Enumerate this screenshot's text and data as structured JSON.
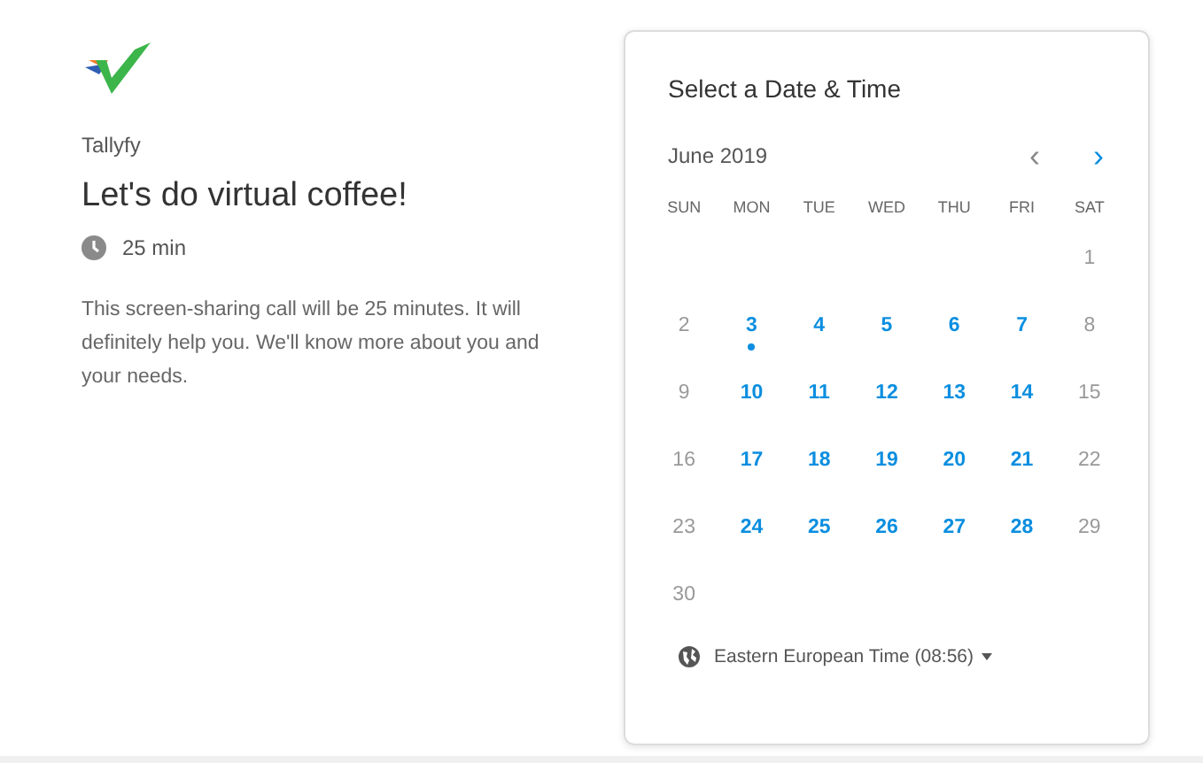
{
  "organizer": "Tallyfy",
  "event_title": "Let's do virtual coffee!",
  "duration": "25 min",
  "description": "This screen-sharing call will be 25 minutes. It will definitely help you. We'll know more about you and your needs.",
  "calendar": {
    "heading": "Select a Date & Time",
    "month": "June 2019",
    "prev_month": {
      "glyph": "‹",
      "disabled": true
    },
    "next_month": {
      "glyph": "›",
      "disabled": false
    },
    "weekdays": [
      "SUN",
      "MON",
      "TUE",
      "WED",
      "THU",
      "FRI",
      "SAT"
    ],
    "weeks": [
      {
        "kind": "lead",
        "days": [
          {
            "label": "1",
            "available": false,
            "today": false
          }
        ]
      },
      {
        "kind": "full",
        "days": [
          {
            "label": "2",
            "available": false,
            "today": false
          },
          {
            "label": "3",
            "available": true,
            "today": true
          },
          {
            "label": "4",
            "available": true,
            "today": false
          },
          {
            "label": "5",
            "available": true,
            "today": false
          },
          {
            "label": "6",
            "available": true,
            "today": false
          },
          {
            "label": "7",
            "available": true,
            "today": false
          },
          {
            "label": "8",
            "available": false,
            "today": false
          }
        ]
      },
      {
        "kind": "full",
        "days": [
          {
            "label": "9",
            "available": false,
            "today": false
          },
          {
            "label": "10",
            "available": true,
            "today": false
          },
          {
            "label": "11",
            "available": true,
            "today": false
          },
          {
            "label": "12",
            "available": true,
            "today": false
          },
          {
            "label": "13",
            "available": true,
            "today": false
          },
          {
            "label": "14",
            "available": true,
            "today": false
          },
          {
            "label": "15",
            "available": false,
            "today": false
          }
        ]
      },
      {
        "kind": "full",
        "days": [
          {
            "label": "16",
            "available": false,
            "today": false
          },
          {
            "label": "17",
            "available": true,
            "today": false
          },
          {
            "label": "18",
            "available": true,
            "today": false
          },
          {
            "label": "19",
            "available": true,
            "today": false
          },
          {
            "label": "20",
            "available": true,
            "today": false
          },
          {
            "label": "21",
            "available": true,
            "today": false
          },
          {
            "label": "22",
            "available": false,
            "today": false
          }
        ]
      },
      {
        "kind": "full",
        "days": [
          {
            "label": "23",
            "available": false,
            "today": false
          },
          {
            "label": "24",
            "available": true,
            "today": false
          },
          {
            "label": "25",
            "available": true,
            "today": false
          },
          {
            "label": "26",
            "available": true,
            "today": false
          },
          {
            "label": "27",
            "available": true,
            "today": false
          },
          {
            "label": "28",
            "available": true,
            "today": false
          },
          {
            "label": "29",
            "available": false,
            "today": false
          }
        ]
      },
      {
        "kind": "tail",
        "days": [
          {
            "label": "30",
            "available": false,
            "today": false
          }
        ]
      }
    ],
    "timezone": "Eastern European Time (08:56)"
  }
}
